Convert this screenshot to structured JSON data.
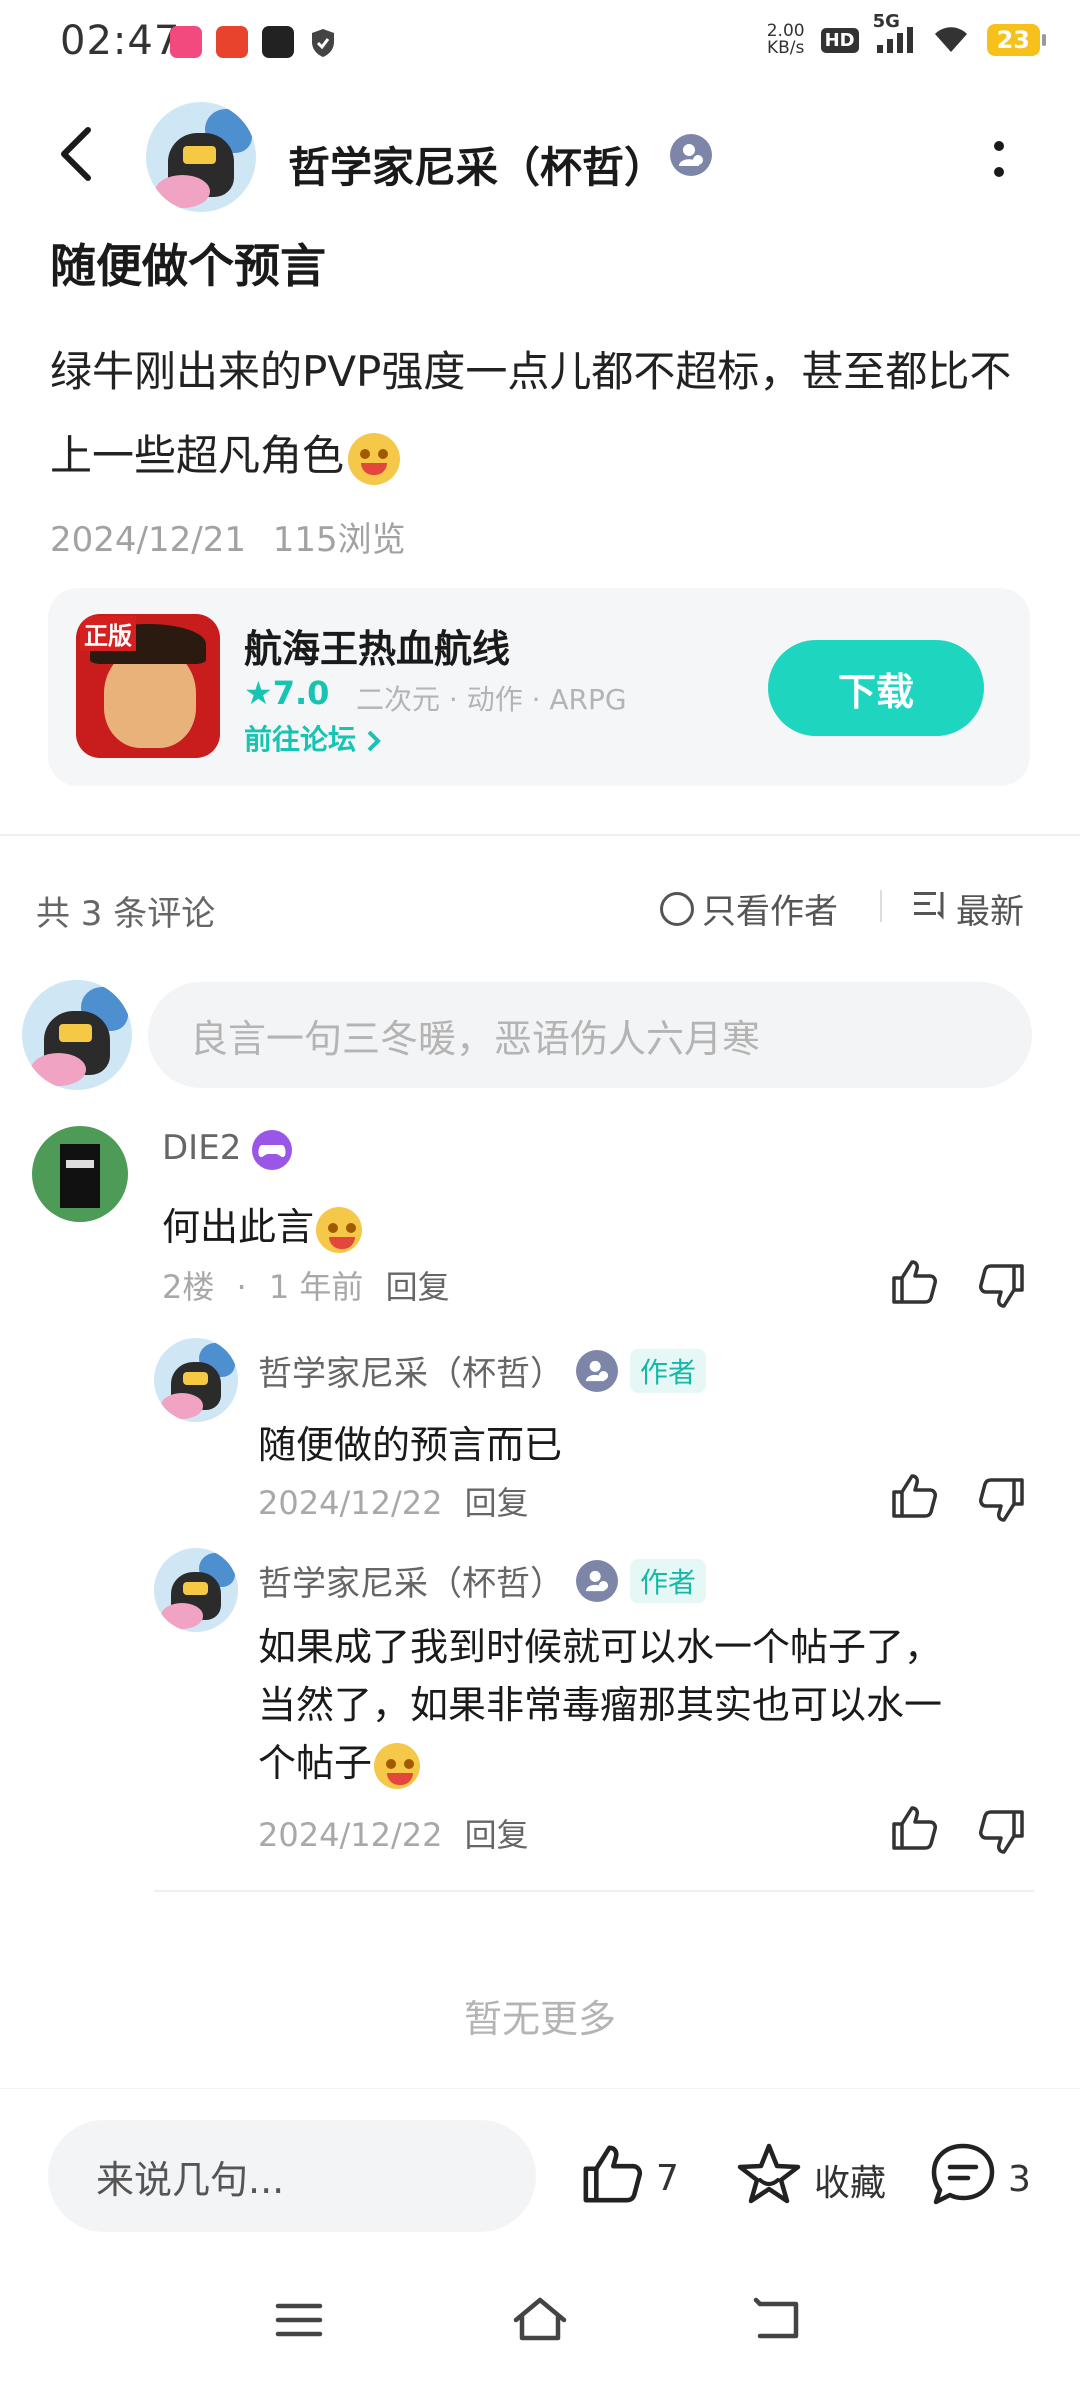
{
  "status_bar": {
    "time": "02:47",
    "net_speed_value": "2.00",
    "net_speed_unit": "KB/s",
    "hd": "HD",
    "network": "5G",
    "battery": "23"
  },
  "header": {
    "username": "哲学家尼采（杯哲）"
  },
  "post": {
    "title": "随便做个预言",
    "body": "绿牛刚出来的PVP强度一点儿都不超标，甚至都比不上一些超凡角色",
    "date": "2024/12/21",
    "views": "115浏览"
  },
  "game_card": {
    "icon_tag": "正版",
    "name": "航海王热血航线",
    "rating": "7.0",
    "tags": "二次元 · 动作 · ARPG",
    "forum_link": "前往论坛",
    "download": "下载"
  },
  "comments_header": {
    "count": "共 3 条评论",
    "only_author": "只看作者",
    "sort": "最新"
  },
  "comment_input_placeholder": "良言一句三冬暖，恶语伤人六月寒",
  "comments": [
    {
      "name": "DIE2",
      "text": "何出此言",
      "floor": "2楼",
      "time": "1 年前",
      "reply": "回复"
    }
  ],
  "replies": [
    {
      "name": "哲学家尼采（杯哲）",
      "author_tag": "作者",
      "text": "随便做的预言而已",
      "date": "2024/12/22",
      "reply": "回复"
    },
    {
      "name": "哲学家尼采（杯哲）",
      "author_tag": "作者",
      "text_line1": "如果成了我到时候就可以水一个帖子了，",
      "text_line2": "当然了，如果非常毒瘤那其实也可以水一",
      "text_line3": "个帖子",
      "date": "2024/12/22",
      "reply": "回复"
    }
  ],
  "no_more": "暂无更多",
  "bottom_bar": {
    "input_placeholder": "来说几句...",
    "like_count": "7",
    "favorite": "收藏",
    "comment_count": "3"
  },
  "colors": {
    "accent": "#1ed5c0",
    "author_tag": "#17b8a6",
    "badge": "#7d86a8"
  }
}
